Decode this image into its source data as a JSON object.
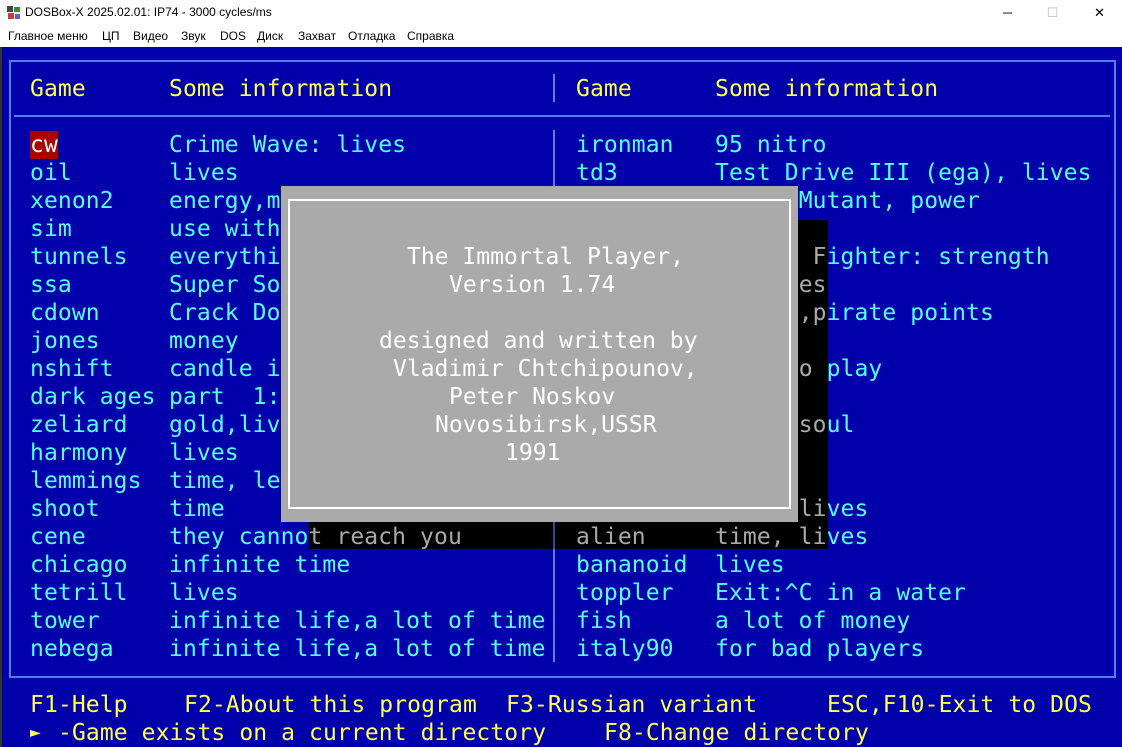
{
  "window": {
    "title": "DOSBox-X 2025.02.01: IP74 - 3000 cycles/ms",
    "minimize": "─",
    "maximize": "☐",
    "close": "✕"
  },
  "menu": [
    "Главное меню",
    "ЦП",
    "Видео",
    "Звук",
    "DOS",
    "Диск",
    "Захват",
    "Отладка",
    "Справка"
  ],
  "headers": {
    "game": "Game",
    "info": "Some information"
  },
  "left_rows": [
    {
      "game": "cw",
      "info": "Crime Wave: lives",
      "selected": true
    },
    {
      "game": "oil",
      "info": "lives"
    },
    {
      "game": "xenon2",
      "info": "energy,m"
    },
    {
      "game": "sim",
      "info": "use with"
    },
    {
      "game": "tunnels",
      "info": "everythi"
    },
    {
      "game": "ssa",
      "info": "Super So"
    },
    {
      "game": "cdown",
      "info": "Crack Do"
    },
    {
      "game": "jones",
      "info": "money"
    },
    {
      "game": "nshift",
      "info": "candle i"
    },
    {
      "game": "dark ages",
      "info": "part  1:"
    },
    {
      "game": "zeliard",
      "info": "gold,liv"
    },
    {
      "game": "harmony",
      "info": "lives"
    },
    {
      "game": "lemmings",
      "info": "time, le"
    },
    {
      "game": "shoot",
      "info": "time"
    },
    {
      "game": "cene",
      "info": "they cannot reach you"
    },
    {
      "game": "chicago",
      "info": "infinite time"
    },
    {
      "game": "tetrill",
      "info": "lives"
    },
    {
      "game": "tower",
      "info": "infinite life,a lot of time"
    },
    {
      "game": "nebega",
      "info": "infinite life,a lot of time"
    }
  ],
  "right_rows": [
    {
      "game": "ironman",
      "info": "95 nitro"
    },
    {
      "game": "td3",
      "info": "Test Drive III (ega), lives"
    },
    {
      "game": "",
      "info": "Mutant, power",
      "offset": 6
    },
    {
      "game": "",
      "info": ""
    },
    {
      "game": "",
      "info": "Fighter: strength",
      "offset": 7
    },
    {
      "game": "",
      "info": "es",
      "offset": 6
    },
    {
      "game": "",
      "info": ",pirate points",
      "offset": 6
    },
    {
      "game": "",
      "info": ""
    },
    {
      "game": "",
      "info": "o play",
      "offset": 6
    },
    {
      "game": "",
      "info": ""
    },
    {
      "game": "",
      "info": "soul",
      "offset": 6
    },
    {
      "game": "",
      "info": ""
    },
    {
      "game": "",
      "info": ""
    },
    {
      "game": "",
      "info": "lives",
      "offset": 6
    },
    {
      "game": "alien",
      "info": "time, lives"
    },
    {
      "game": "bananoid",
      "info": "lives"
    },
    {
      "game": "toppler",
      "info": "Exit:^C in a water"
    },
    {
      "game": "fish",
      "info": "a lot of money"
    },
    {
      "game": "italy90",
      "info": "for bad players"
    }
  ],
  "footer": {
    "f1": "F1-Help",
    "f2": "F2-About this program",
    "f3": "F3-Russian variant",
    "exit": "ESC,F10-Exit to DOS",
    "marker": "►",
    "legend": "-Game exists on a current directory",
    "f8": "F8-Change directory"
  },
  "about_dialog": {
    "lines": [
      "The Immortal Player,",
      "Version 1.74",
      "designed and written by",
      "Vladimir Chtchipounov,",
      "Peter Noskov",
      "Novosibirsk,USSR",
      "1991"
    ]
  },
  "colors": {
    "background": "#0000aa",
    "text": "#55ffff",
    "accent": "#ffff55",
    "selection": "#aa0000",
    "dialog": "#aaaaaa"
  }
}
